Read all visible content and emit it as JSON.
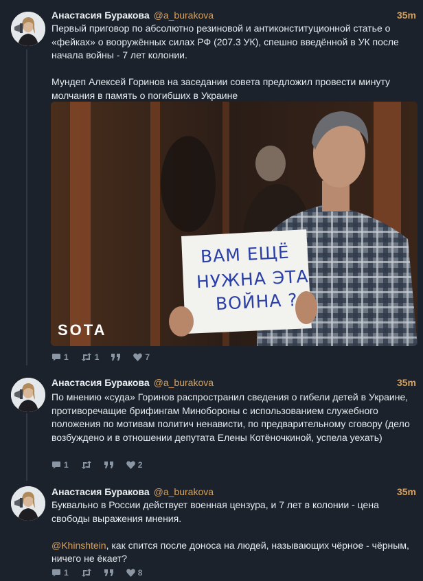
{
  "tweets": [
    {
      "name": "Анастасия Буракова",
      "handle": "@a_burakova",
      "time": "35m",
      "text1": "Первый приговор по абсолютно резиновой и антиконституционной статье о «фейках» о вооружённых силах РФ (207.3 УК), спешно введённой в УК после начала войны - 7 лет колонии.",
      "text2": "Мундеп Алексей Горинов на заседании совета предложил провести минуту молчания в память о погибших в Украине",
      "photo": {
        "sign_line1": "ВАМ ЕЩЁ",
        "sign_line2": "НУЖНА ЭТА",
        "sign_line3": "ВОЙНА ?",
        "watermark": "SOTA"
      },
      "replies": "1",
      "retweets": "1",
      "likes": "7"
    },
    {
      "name": "Анастасия Буракова",
      "handle": "@a_burakova",
      "time": "35m",
      "text1": "По мнению «суда» Горинов распространил сведения о гибели детей в Украине, противоречащие брифингам Минобороны с использованием служебного положения по мотивам политич ненависти, по предварительному сговору (дело возбуждено и в отношении депутата Елены Котёночкиной, успела уехать)",
      "replies": "1",
      "likes": "2"
    },
    {
      "name": "Анастасия Буракова",
      "handle": "@a_burakova",
      "time": "35m",
      "text1": "Буквально в России действует военная цензура, и 7 лет в колонии - цена свободы выражения мнения.",
      "mention": "@Khinshtein",
      "text2": ", как спится после доноса на людей, называющих чёрное - чёрным, ничего не ёкает?",
      "replies": "1",
      "likes": "8"
    }
  ],
  "colors": {
    "background": "#1b222b",
    "accent": "#d9a15b",
    "muted": "#8a96a3",
    "text": "#e6ebf0"
  },
  "icons": [
    "reply-icon",
    "retweet-icon",
    "quote-icon",
    "heart-icon"
  ]
}
